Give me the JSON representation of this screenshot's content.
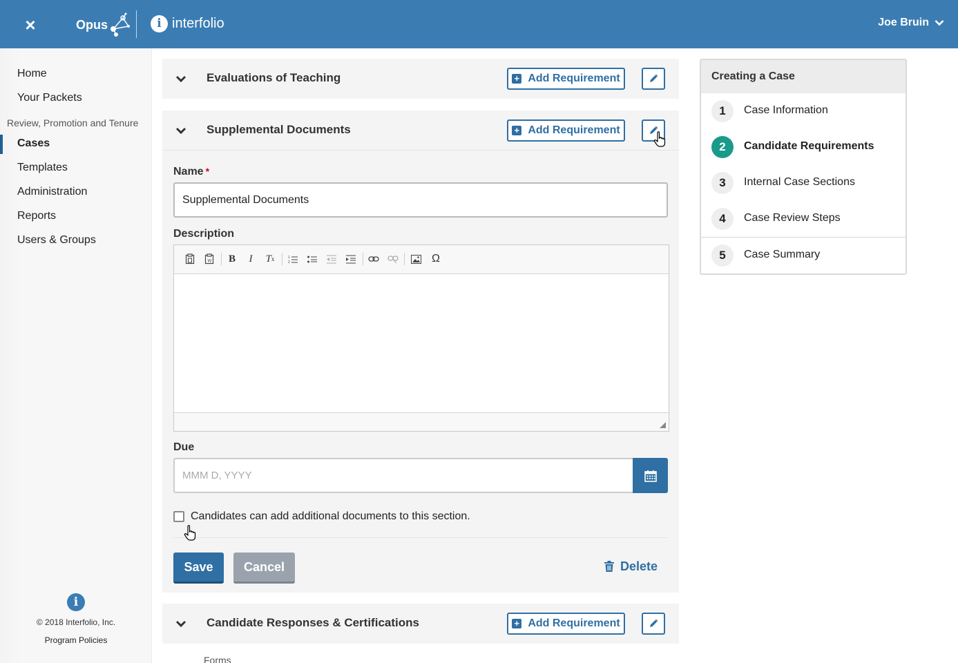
{
  "header": {
    "close_label": "×",
    "opus_label": "Opus",
    "interfolio_label": "interfolio",
    "user_name": "Joe Bruin",
    "brand_color": "#3b7db3"
  },
  "sidebar": {
    "items": [
      {
        "label": "Home"
      },
      {
        "label": "Your Packets"
      },
      {
        "label": "Cases"
      },
      {
        "label": "Templates"
      },
      {
        "label": "Administration"
      },
      {
        "label": "Reports"
      },
      {
        "label": "Users & Groups"
      }
    ],
    "section_label": "Review, Promotion and Tenure",
    "active_item": "Cases",
    "copyright": "© 2018 Interfolio, Inc.",
    "policies_link": "Program Policies"
  },
  "sections": [
    {
      "title": "Evaluations of Teaching",
      "add_label": "Add Requirement"
    },
    {
      "title": "Supplemental Documents",
      "add_label": "Add Requirement"
    },
    {
      "title": "Candidate Responses & Certifications",
      "add_label": "Add Requirement"
    }
  ],
  "form": {
    "name_label": "Name",
    "required_mark": "*",
    "name_value": "Supplemental Documents",
    "description_label": "Description",
    "due_label": "Due",
    "due_placeholder": "MMM D, YYYY",
    "checkbox_label": "Candidates can add additional documents to this section.",
    "checkbox_checked": false,
    "save_label": "Save",
    "cancel_label": "Cancel",
    "delete_label": "Delete",
    "toolbar_buttons": [
      "paste-icon",
      "paste-from-word-icon",
      "bold-icon",
      "italic-icon",
      "remove-format-icon",
      "numbered-list-icon",
      "bulleted-list-icon",
      "decrease-indent-icon",
      "increase-indent-icon",
      "link-icon",
      "unlink-icon",
      "image-icon",
      "special-character-icon"
    ]
  },
  "forms_peek_label": "Forms",
  "steps": {
    "title": "Creating a Case",
    "items": [
      {
        "num": "1",
        "label": "Case Information"
      },
      {
        "num": "2",
        "label": "Candidate Requirements"
      },
      {
        "num": "3",
        "label": "Internal Case Sections"
      },
      {
        "num": "4",
        "label": "Case Review Steps"
      },
      {
        "num": "5",
        "label": "Case Summary"
      }
    ],
    "active_step": "2",
    "active_color": "#1a9a8a"
  }
}
